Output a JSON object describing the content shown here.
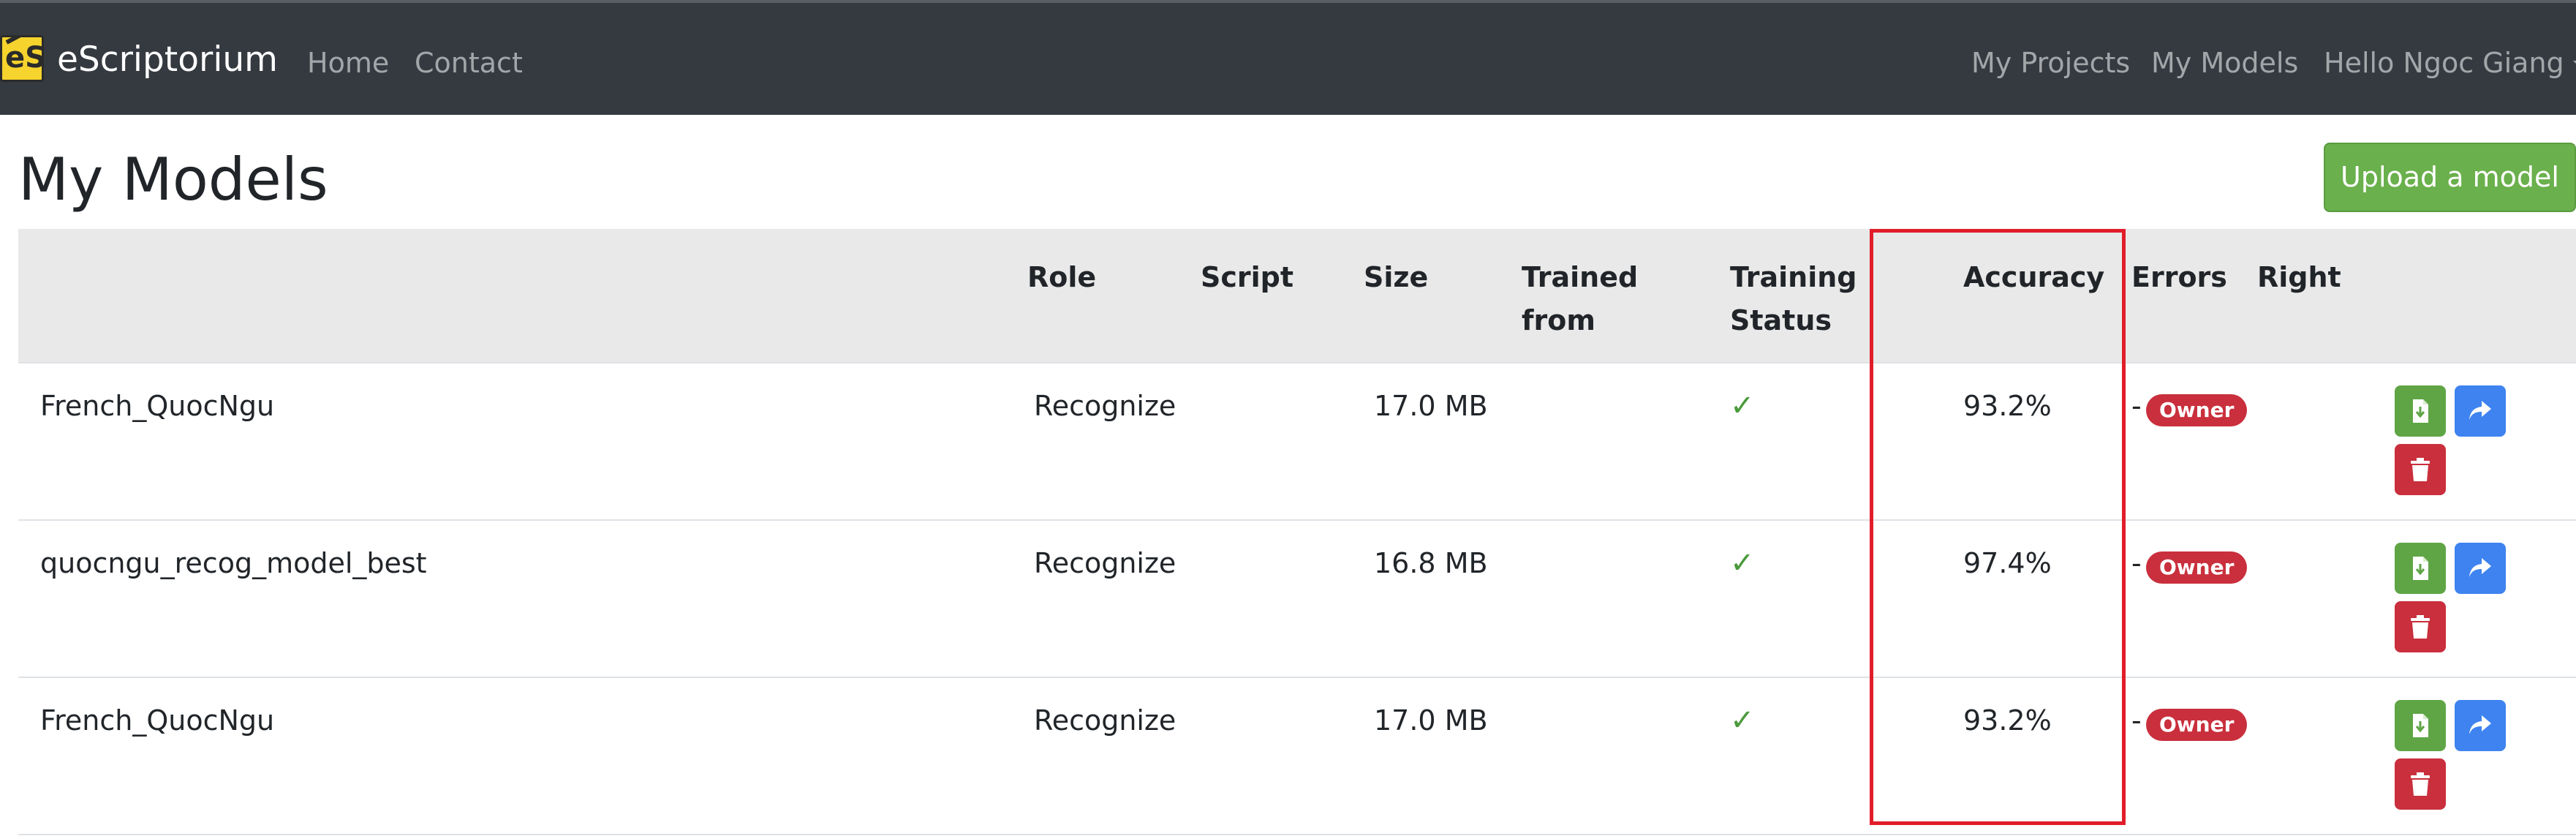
{
  "navbar": {
    "brand_logo_text": "eS",
    "brand_name": "eScriptorium",
    "links": {
      "home": "Home",
      "contact": "Contact",
      "my_projects": "My Projects",
      "my_models": "My Models",
      "user": "Hello Ngoc Giang"
    }
  },
  "page": {
    "title": "My Models",
    "upload_button": "Upload a model"
  },
  "table": {
    "headers": {
      "role": "Role",
      "script": "Script",
      "size": "Size",
      "trained_from_line1": "Trained",
      "trained_from_line2": "from",
      "training_status_line1": "Training",
      "training_status_line2": "Status",
      "accuracy": "Accuracy",
      "errors": "Errors",
      "right": "Right"
    },
    "rows": [
      {
        "name": "French_QuocNgu",
        "role": "Recognize",
        "script": "",
        "size": "17.0 MB",
        "trained_from": "",
        "training_status": "✓",
        "accuracy": "93.2%",
        "errors": "-",
        "right": "Owner"
      },
      {
        "name": "quocngu_recog_model_best",
        "role": "Recognize",
        "script": "",
        "size": "16.8 MB",
        "trained_from": "",
        "training_status": "✓",
        "accuracy": "97.4%",
        "errors": "-",
        "right": "Owner"
      },
      {
        "name": "French_QuocNgu",
        "role": "Recognize",
        "script": "",
        "size": "17.0 MB",
        "trained_from": "",
        "training_status": "✓",
        "accuracy": "93.2%",
        "errors": "-",
        "right": "Owner"
      }
    ]
  },
  "icons": {
    "download": "file-download-icon",
    "share": "share-icon",
    "delete": "trash-icon"
  },
  "colors": {
    "navbar_bg": "#343a40",
    "success": "#6ab04c",
    "primary": "#3e83f0",
    "danger": "#c92f3c",
    "highlight": "#e11d2a"
  }
}
